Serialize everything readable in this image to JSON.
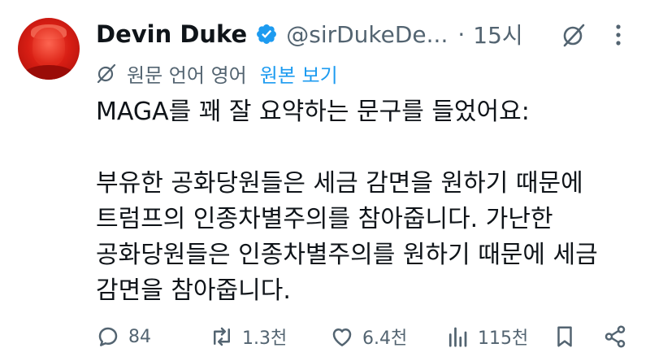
{
  "author": {
    "name": "Devin Duke",
    "handle": "@sirDukeDe...",
    "separator": "·",
    "time": "15시"
  },
  "translation": {
    "label": "원문 언어 영어",
    "link": "원본 보기"
  },
  "tweet": {
    "text": "MAGA를 꽤 잘 요약하는 문구를 들었어요:\n\n부유한 공화당원들은 세금 감면을 원하기 때문에\n트럼프의 인종차별주의를 참아줍니다. 가난한\n공화당원들은 인종차별주의를 원하기 때문에 세금\n감면을 참아줍니다."
  },
  "actions": {
    "replies": "84",
    "retweets": "1.3천",
    "likes": "6.4천",
    "views": "115천"
  },
  "colors": {
    "text": "#0f1419",
    "muted": "#536471",
    "link": "#1d9bf0",
    "verified": "#1d9bf0",
    "avatar": "#d81e14"
  },
  "icons": [
    "verified-badge-icon",
    "grok-icon",
    "more-icon",
    "translate-icon",
    "reply-icon",
    "retweet-icon",
    "like-icon",
    "views-icon",
    "bookmark-icon",
    "share-icon"
  ]
}
